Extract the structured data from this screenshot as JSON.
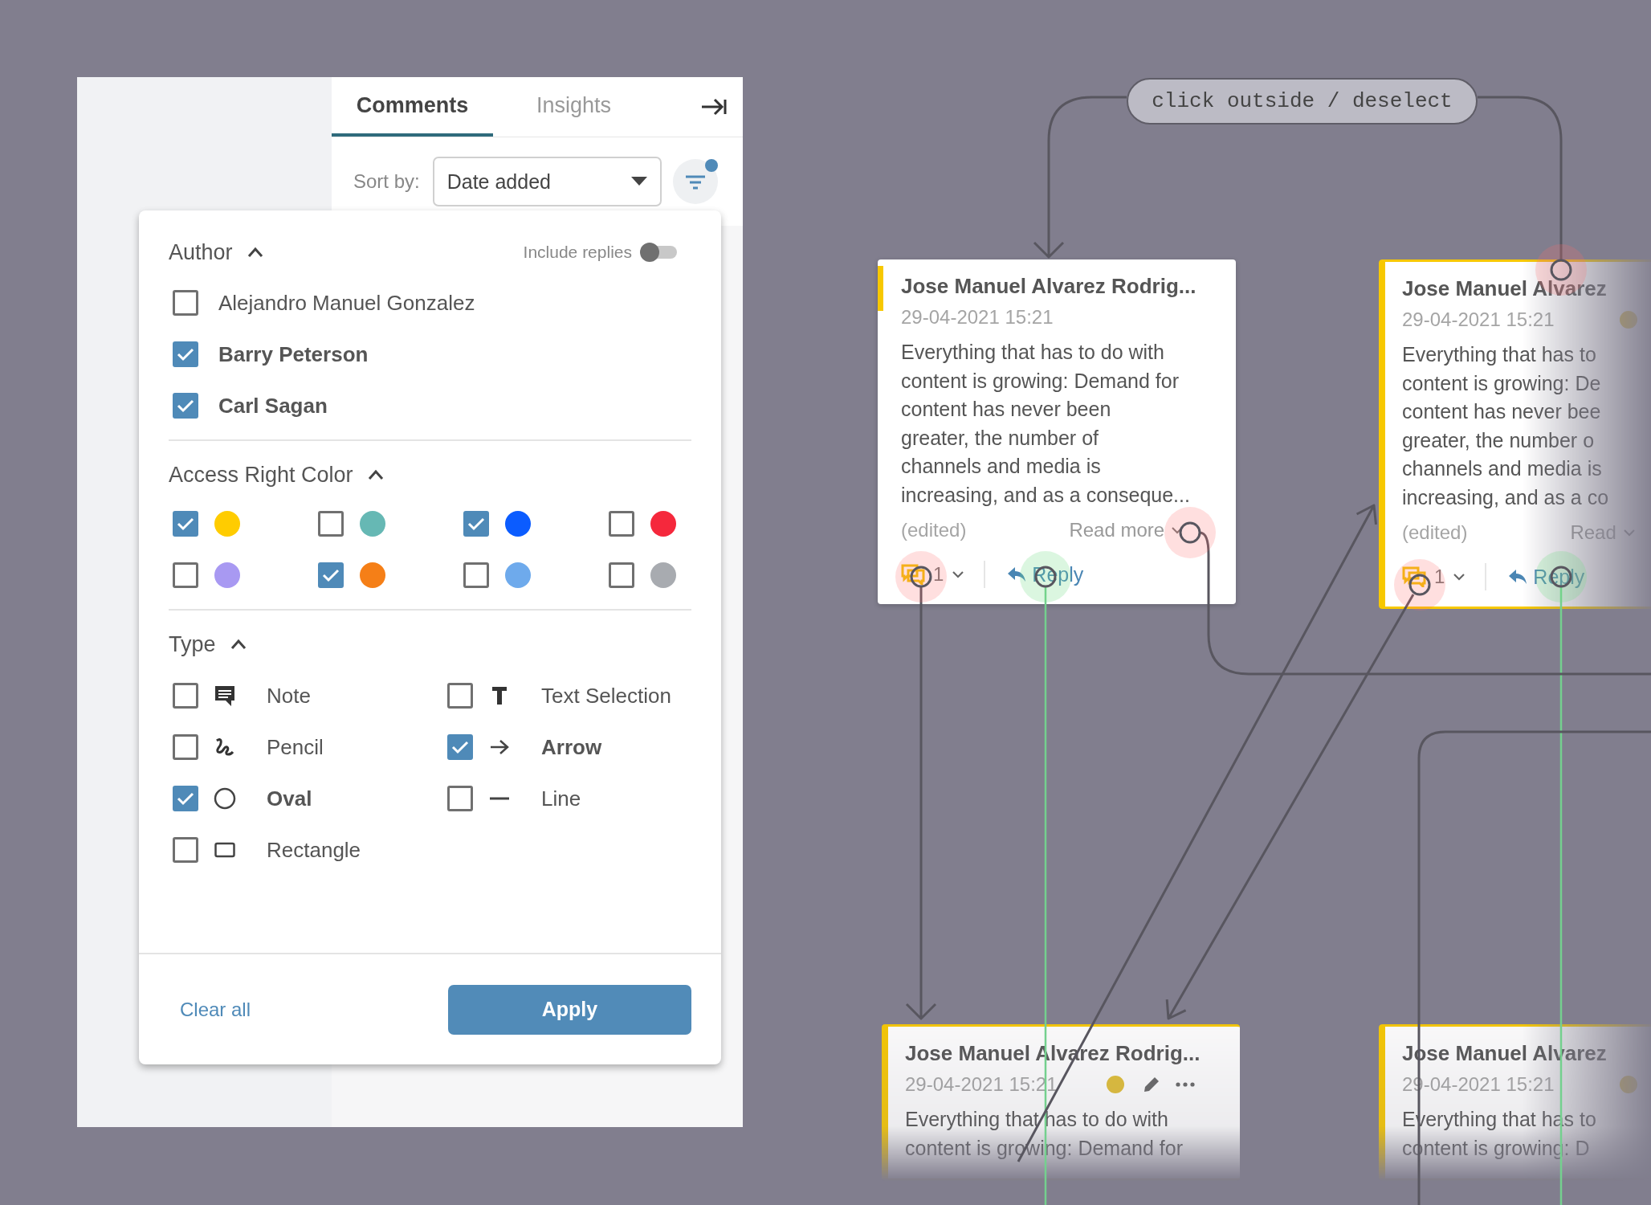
{
  "tabs": [
    {
      "label": "Comments",
      "selected": true
    },
    {
      "label": "Insights",
      "selected": false
    }
  ],
  "sort": {
    "label": "Sort by:",
    "value": "Date added"
  },
  "filter_button": {
    "active": true
  },
  "filter_panel": {
    "author": {
      "title": "Author",
      "expanded": true,
      "include_replies": {
        "label": "Include replies",
        "on": false
      },
      "options": [
        {
          "label": "Alejandro Manuel Gonzalez",
          "checked": false
        },
        {
          "label": "Barry Peterson",
          "checked": true
        },
        {
          "label": "Carl Sagan",
          "checked": true
        }
      ]
    },
    "access_right_color": {
      "title": "Access Right Color",
      "expanded": true,
      "options": [
        {
          "color": "#ffcc00",
          "checked": true
        },
        {
          "color": "#66b8b4",
          "checked": false
        },
        {
          "color": "#0b5cff",
          "checked": true
        },
        {
          "color": "#f5283c",
          "checked": false
        },
        {
          "color": "#a899f2",
          "checked": false
        },
        {
          "color": "#f57f17",
          "checked": true
        },
        {
          "color": "#6eaaec",
          "checked": false
        },
        {
          "color": "#a8abb0",
          "checked": false
        }
      ]
    },
    "type": {
      "title": "Type",
      "expanded": true,
      "options": [
        {
          "label": "Note",
          "kind": "note",
          "checked": false
        },
        {
          "label": "Text Selection",
          "kind": "text",
          "checked": false
        },
        {
          "label": "Pencil",
          "kind": "pencil",
          "checked": false
        },
        {
          "label": "Arrow",
          "kind": "arrow",
          "checked": true
        },
        {
          "label": "Oval",
          "kind": "oval",
          "checked": true
        },
        {
          "label": "Line",
          "kind": "line",
          "checked": false
        },
        {
          "label": "Rectangle",
          "kind": "rectangle",
          "checked": false
        }
      ]
    },
    "clear_label": "Clear all",
    "apply_label": "Apply"
  },
  "canvas": {
    "hint": "click outside / deselect",
    "cards": [
      {
        "selected": false,
        "title": "Jose Manuel Alvarez Rodrig...",
        "date": "29-04-2021 15:21",
        "dot": false,
        "actions": false,
        "body": [
          "Everything that has to do with",
          "content is growing: Demand for",
          "content has never been",
          "greater, the number of",
          "channels and media is",
          "increasing, and as a conseque..."
        ],
        "edited": "(edited)",
        "read_more": "Read more",
        "replies": "1",
        "reply": "Reply"
      },
      {
        "selected": true,
        "title": "Jose Manuel Alvarez",
        "date": "29-04-2021 15:21",
        "dot": true,
        "actions": false,
        "body": [
          "Everything that has to",
          "content is growing: De",
          "content has never bee",
          "greater, the number o",
          "channels and media is",
          "increasing, and as a co"
        ],
        "edited": "(edited)",
        "read_more": "Read",
        "replies": "1",
        "reply": "Reply"
      },
      {
        "selected": true,
        "title": "Jose Manuel Alvarez Rodrig...",
        "date": "29-04-2021 15:21",
        "dot": true,
        "actions": true,
        "body": [
          "Everything that has to do with",
          "content is growing: Demand for"
        ]
      },
      {
        "selected": true,
        "title": "Jose Manuel Alvarez",
        "date": "29-04-2021 15:21",
        "dot": true,
        "actions": false,
        "body": [
          "Everything that has to",
          "content is growing: D"
        ]
      }
    ]
  }
}
